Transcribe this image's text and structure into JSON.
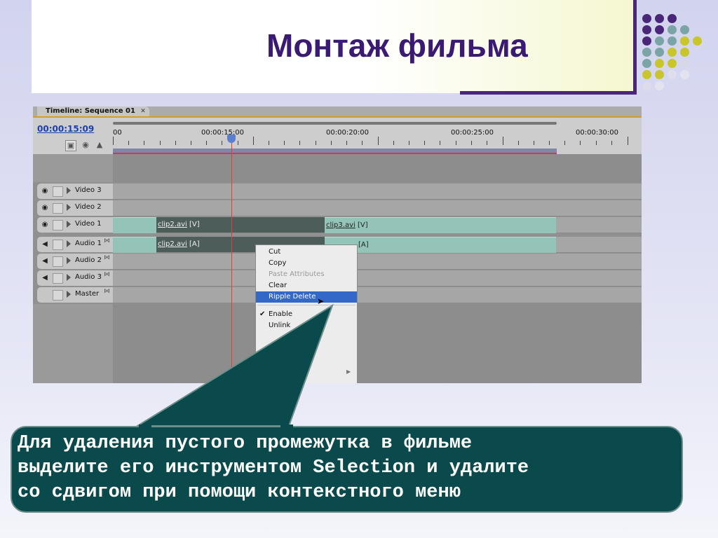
{
  "slide": {
    "title": "Монтаж фильма",
    "caption_lines": [
      "Для удаления пустого промежутка в фильме",
      "выделите его инструментом Selection и удалите",
      "со сдвигом при помощи контекстного меню"
    ],
    "colors": {
      "title": "#3b1a73",
      "accent_purple": "#4a2679",
      "callout_bg": "#0b4a4c",
      "dot_purple": "#4a2679",
      "dot_teal": "#7aa4a6",
      "dot_yellow": "#c8c62a"
    }
  },
  "panel": {
    "tab_label": "Timeline: Sequence 01",
    "close_icon": "close-icon",
    "timecode": "00:00:15:09",
    "ruler": {
      "labels": [
        "00",
        "00:00:15:00",
        "00:00:20:00",
        "00:00:25:00",
        "00:00:30:00"
      ]
    },
    "tracks": [
      {
        "name": "Video 3",
        "icon": "eye-icon"
      },
      {
        "name": "Video 2",
        "icon": "eye-icon"
      },
      {
        "name": "Video 1",
        "icon": "eye-icon"
      },
      {
        "name": "Audio 1",
        "icon": "speaker-icon"
      },
      {
        "name": "Audio 2",
        "icon": "speaker-icon"
      },
      {
        "name": "Audio 3",
        "icon": "speaker-icon"
      },
      {
        "name": "Master",
        "icon": ""
      }
    ],
    "clips": {
      "v1_a": "clip2.avi",
      "v1_a_tag": "[V]",
      "v1_b": "clip3.avi",
      "v1_b_tag": "[V]",
      "a1_a": "clip2.avi",
      "a1_a_tag": "[A]",
      "a1_b_tag": "[A]"
    }
  },
  "context_menu": {
    "items": [
      {
        "label": "Cut",
        "state": "enabled"
      },
      {
        "label": "Copy",
        "state": "enabled"
      },
      {
        "label": "Paste Attributes",
        "state": "disabled"
      },
      {
        "label": "Clear",
        "state": "enabled"
      },
      {
        "label": "Ripple Delete",
        "state": "selected"
      },
      {
        "label": "Enable",
        "state": "checked"
      },
      {
        "label": "Unlink",
        "state": "enabled"
      }
    ],
    "check_icon": "check-icon",
    "cursor_icon": "arrow-cursor-icon",
    "submenu_arrow_icon": "chevron-right-icon"
  }
}
